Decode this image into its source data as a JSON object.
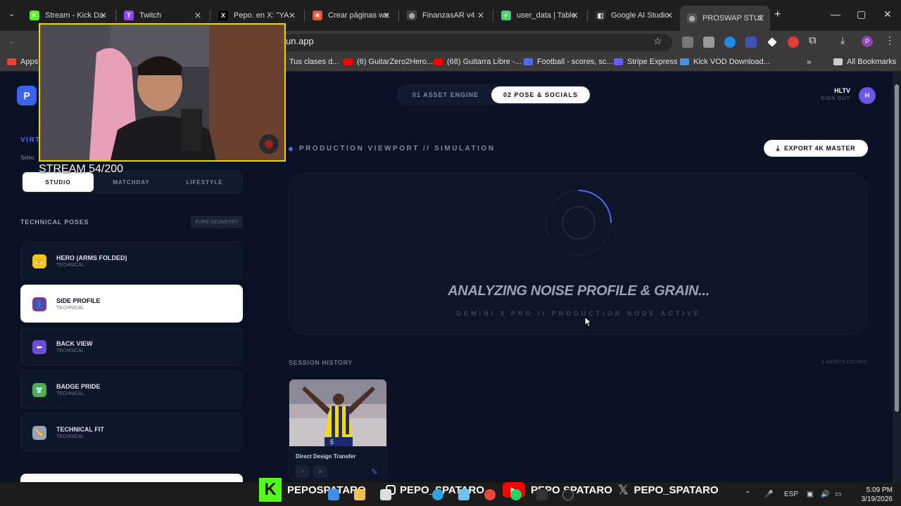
{
  "browser": {
    "tabs": [
      {
        "title": "Stream - Kick Da",
        "icon_color": "#53fc18",
        "glyph": "K"
      },
      {
        "title": "Twitch",
        "icon_color": "#9146ff",
        "glyph": "T"
      },
      {
        "title": "Pepo. en X: \"YA ",
        "icon_color": "#000000",
        "glyph": "X"
      },
      {
        "title": "Crear páginas we",
        "icon_color": "#e25c3a",
        "glyph": "✳"
      },
      {
        "title": "FinanzasAR v4",
        "icon_color": "#444444",
        "glyph": "◎"
      },
      {
        "title": "user_data | Table",
        "icon_color": "#3ecf8e",
        "glyph": "⚡"
      },
      {
        "title": "Google AI Studio",
        "icon_color": "#333333",
        "glyph": "◧"
      },
      {
        "title": "PROSWAP STUDIO",
        "icon_color": "#555555",
        "glyph": "◎"
      }
    ],
    "url": "un.app",
    "bookmarks": [
      {
        "label": "Apps",
        "color": "#ea4335"
      },
      {
        "label": "Tus clases d...",
        "color": "#e04040"
      },
      {
        "label": "(6) GuitarZero2Hero...",
        "color": "#ff0000"
      },
      {
        "label": "(68) Guitarra Libre -...",
        "color": "#ff0000"
      },
      {
        "label": "Football - scores, sc...",
        "color": "#5468ff"
      },
      {
        "label": "Stripe Express",
        "color": "#635bff"
      },
      {
        "label": "Kick VOD Download...",
        "color": "#4a90e2"
      },
      {
        "label": "All Bookmarks",
        "color": "#cccccc"
      }
    ]
  },
  "app": {
    "logo": "P",
    "nav": {
      "tab1": "01 ASSET ENGINE",
      "tab2": "02 POSE & SOCIALS"
    },
    "user": {
      "name": "HLTV",
      "signout": "SIGN OUT",
      "avatar": "H"
    },
    "sidebar": {
      "section_title": "VIRT",
      "section_sub": "Selec",
      "segments": [
        "STUDIO",
        "MATCHDAY",
        "LIFESTYLE"
      ],
      "technical_title": "TECHNICAL POSES",
      "technical_badge": "PURE GEOMETRY",
      "poses": [
        {
          "name": "HERO (ARMS FOLDED)",
          "sub": "TECHNICAL",
          "icon": "emoji",
          "color": "#f5c518",
          "glyph": "😤"
        },
        {
          "name": "SIDE PROFILE",
          "sub": "TECHNICAL",
          "icon": "silhouette",
          "color": "#6b3fa0",
          "glyph": "👤"
        },
        {
          "name": "BACK VIEW",
          "sub": "TECHNICAL",
          "icon": "back-arrow",
          "color": "#6b4fd0",
          "glyph": "⬅"
        },
        {
          "name": "BADGE PRIDE",
          "sub": "TECHNICAL",
          "icon": "shirt",
          "color": "#4caf50",
          "glyph": "👕"
        },
        {
          "name": "TECHNICAL FIT",
          "sub": "TECHNICAL",
          "icon": "ruler",
          "color": "#9aa3b8",
          "glyph": "📏"
        }
      ]
    },
    "viewport": {
      "title": "PRODUCTION VIEWPORT // SIMULATION",
      "export": "EXPORT 4K MASTER",
      "status": "ANALYZING NOISE PROFILE & GRAIN...",
      "status_sub": "GEMINI 3 PRO // PRODUCTION NODE ACTIVE"
    },
    "history": {
      "title": "SESSION HISTORY",
      "count": "1 ASSETS CACHED",
      "item_caption": "Direct Design Transfer",
      "jersey_number": "5"
    }
  },
  "overlay": {
    "stream_text": "STREAM 54/200"
  },
  "taskbar": {
    "socials": [
      {
        "label": "PEPOSPATARO",
        "platform": "kick"
      },
      {
        "label": "PEPO_SPATARO",
        "platform": "instagram"
      },
      {
        "label": "PEPO SPATARO",
        "platform": "youtube"
      },
      {
        "label": "PEPO_SPATARO",
        "platform": "x"
      }
    ],
    "lang": "ESP",
    "time": "5:09 PM",
    "date": "3/19/2026"
  }
}
